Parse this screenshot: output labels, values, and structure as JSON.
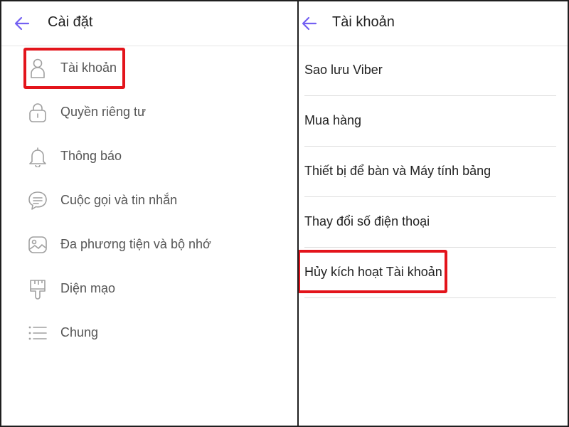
{
  "colors": {
    "accent": "#7360f2",
    "highlight": "#e3141b",
    "icon": "#a0a0a0"
  },
  "left_panel": {
    "title": "Cài đặt",
    "back_icon": "arrow-left-icon",
    "items": [
      {
        "label": "Tài khoản",
        "icon": "person-icon"
      },
      {
        "label": "Quyền riêng tư",
        "icon": "lock-icon"
      },
      {
        "label": "Thông báo",
        "icon": "bell-icon"
      },
      {
        "label": "Cuộc gọi và tin nhắn",
        "icon": "chat-bubble-icon"
      },
      {
        "label": "Đa phương tiện và bộ nhớ",
        "icon": "image-icon"
      },
      {
        "label": "Diện mạo",
        "icon": "paintbrush-icon"
      },
      {
        "label": "Chung",
        "icon": "list-icon"
      }
    ]
  },
  "right_panel": {
    "title": "Tài khoản",
    "back_icon": "arrow-left-icon",
    "items": [
      {
        "label": "Sao lưu Viber"
      },
      {
        "label": "Mua hàng"
      },
      {
        "label": "Thiết bị để bàn và Máy tính bảng"
      },
      {
        "label": "Thay đổi số điện thoại"
      },
      {
        "label": "Hủy kích hoạt Tài khoản"
      }
    ]
  }
}
